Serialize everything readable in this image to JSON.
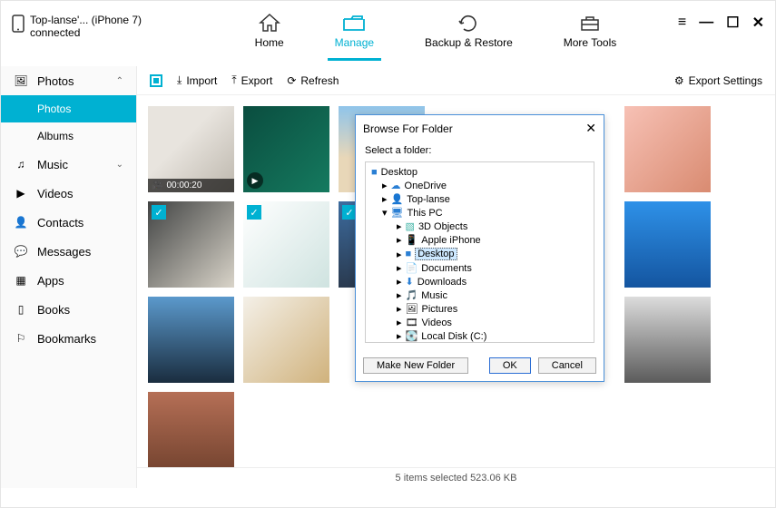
{
  "device": {
    "name": "Top-lanse'... (iPhone 7)",
    "status": "connected"
  },
  "tabs": {
    "home": "Home",
    "manage": "Manage",
    "backup": "Backup & Restore",
    "tools": "More Tools"
  },
  "sidebar": {
    "photos": "Photos",
    "photos_sub": "Photos",
    "albums": "Albums",
    "music": "Music",
    "videos": "Videos",
    "contacts": "Contacts",
    "messages": "Messages",
    "apps": "Apps",
    "books": "Books",
    "bookmarks": "Bookmarks"
  },
  "toolbar": {
    "import": "Import",
    "export": "Export",
    "refresh": "Refresh",
    "exportSettings": "Export Settings"
  },
  "thumbs": {
    "video_duration": "00:00:20"
  },
  "status": "5 items selected 523.06 KB",
  "dialog": {
    "title": "Browse For Folder",
    "prompt": "Select a folder:",
    "nodes": {
      "desktop": "Desktop",
      "onedrive": "OneDrive",
      "user": "Top-lanse",
      "thispc": "This PC",
      "objects3d": "3D Objects",
      "iphone": "Apple iPhone",
      "desktop2": "Desktop",
      "documents": "Documents",
      "downloads": "Downloads",
      "music": "Music",
      "pictures": "Pictures",
      "videos": "Videos",
      "cdrive": "Local Disk (C:)"
    },
    "make_folder": "Make New Folder",
    "ok": "OK",
    "cancel": "Cancel"
  }
}
